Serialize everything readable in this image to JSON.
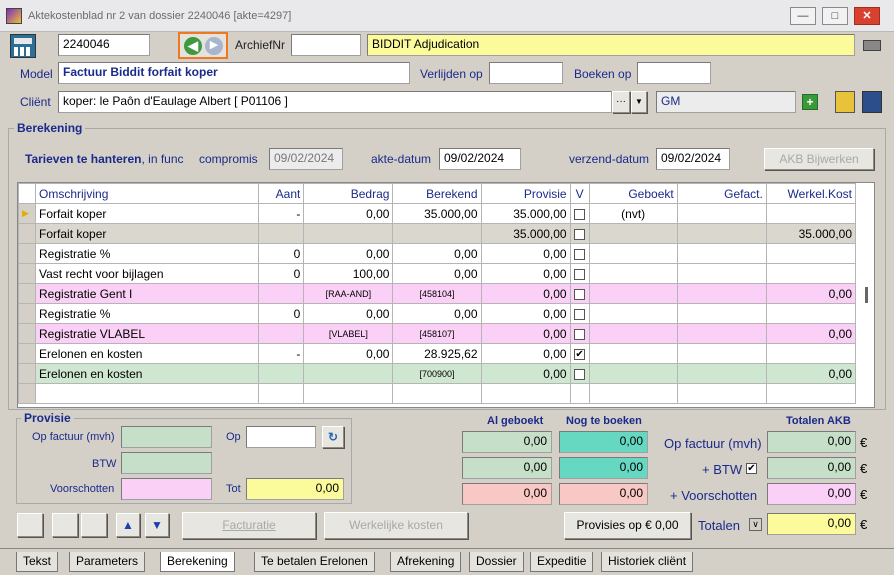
{
  "window": {
    "title": "Aktekostenblad nr 2 van dossier 2240046 [akte=4297]",
    "min": "—",
    "max": "□",
    "close": "✕"
  },
  "header": {
    "dossier_nr": "2240046",
    "archief_label": "ArchiefNr",
    "archief_value": "",
    "description": "BIDDIT Adjudication",
    "model_label": "Model",
    "model_value": "Factuur Biddit forfait koper",
    "verlijden_label": "Verlijden op",
    "verlijden_value": "",
    "boeken_label": "Boeken op",
    "boeken_value": "",
    "client_label": "Cliënt",
    "client_value": "koper: le Paôn d'Eaulage Albert [ P01106 ]",
    "client_code": "GM",
    "ellipsis": "···",
    "dropdown": "▼",
    "plus": "+"
  },
  "berekening": {
    "title": "Berekening",
    "tarieven": "Tarieven te hanteren",
    "infunc": ", in func",
    "compromis_label": "compromis",
    "compromis_value": "09/02/2024",
    "akte_label": "akte-datum",
    "akte_value": "09/02/2024",
    "verzend_label": "verzend-datum",
    "verzend_value": "09/02/2024",
    "akb_button": "AKB Bijwerken"
  },
  "table": {
    "headers": [
      "Omschrijving",
      "Aant",
      "Bedrag",
      "Berekend",
      "Provisie",
      "V",
      "Geboekt",
      "Gefact.",
      "Werkel.Kost"
    ],
    "rows": [
      {
        "style": "white",
        "ptr": "▶",
        "omschrijving": "Forfait koper",
        "aant": "-",
        "bedrag": "0,00",
        "berekend": "35.000,00",
        "provisie": "35.000,00",
        "v": "",
        "geboekt": "(nvt)",
        "gefact": "",
        "werkel": ""
      },
      {
        "style": "gray",
        "ptr": "",
        "omschrijving": "Forfait koper",
        "aant": "",
        "bedrag": "",
        "berekend": "",
        "provisie": "35.000,00",
        "v": "",
        "geboekt": "",
        "gefact": "",
        "werkel": "35.000,00"
      },
      {
        "style": "white",
        "ptr": "",
        "omschrijving": "Registratie %",
        "aant": "0",
        "bedrag": "0,00",
        "berekend": "0,00",
        "provisie": "0,00",
        "v": "",
        "geboekt": "",
        "gefact": "",
        "werkel": ""
      },
      {
        "style": "white",
        "ptr": "",
        "omschrijving": "Vast recht voor bijlagen",
        "aant": "0",
        "bedrag": "100,00",
        "berekend": "0,00",
        "provisie": "0,00",
        "v": "",
        "geboekt": "",
        "gefact": "",
        "werkel": ""
      },
      {
        "style": "pink",
        "ptr": "",
        "omschrijving": "Registratie Gent I",
        "aant": "",
        "bedrag": "[RAA-AND]",
        "berekend": "[458104]",
        "provisie": "0,00",
        "v": "",
        "geboekt": "",
        "gefact": "",
        "werkel": "0,00",
        "small": true
      },
      {
        "style": "white",
        "ptr": "",
        "omschrijving": "Registratie %",
        "aant": "0",
        "bedrag": "0,00",
        "berekend": "0,00",
        "provisie": "0,00",
        "v": "",
        "geboekt": "",
        "gefact": "",
        "werkel": ""
      },
      {
        "style": "pink",
        "ptr": "",
        "omschrijving": "Registratie VLABEL",
        "aant": "",
        "bedrag": "[VLABEL]",
        "berekend": "[458107]",
        "provisie": "0,00",
        "v": "",
        "geboekt": "",
        "gefact": "",
        "werkel": "0,00",
        "small": true
      },
      {
        "style": "white",
        "ptr": "",
        "omschrijving": "Erelonen en kosten",
        "aant": "-",
        "bedrag": "0,00",
        "berekend": "28.925,62",
        "provisie": "0,00",
        "v": "✔",
        "geboekt": "",
        "gefact": "",
        "werkel": ""
      },
      {
        "style": "green",
        "ptr": "",
        "omschrijving": "Erelonen en kosten",
        "aant": "",
        "bedrag": "",
        "berekend": "[700900]",
        "provisie": "0,00",
        "v": "",
        "geboekt": "",
        "gefact": "",
        "werkel": "0,00",
        "small2": true
      }
    ]
  },
  "provisie": {
    "title": "Provisie",
    "op_factuur_label": "Op factuur (mvh)",
    "btw_label": "BTW",
    "voorschotten_label": "Voorschotten",
    "op_label": "Op",
    "tot_label": "Tot",
    "tot_value": "0,00",
    "op_value": ""
  },
  "totals": {
    "al_geboekt": "Al geboekt",
    "nog_te_boeken": "Nog te boeken",
    "totalen_akb": "Totalen AKB",
    "op_factuur": "Op factuur (mvh)",
    "btw": "+ BTW",
    "voorschotten": "+ Voorschotten",
    "totalen": "Totalen",
    "rows": [
      {
        "a": "0,00",
        "b": "0,00",
        "c": "0,00"
      },
      {
        "a": "0,00",
        "b": "0,00",
        "c": "0,00"
      },
      {
        "a": "0,00",
        "b": "0,00",
        "c": "0,00"
      }
    ],
    "grand": "0,00",
    "euro": "€"
  },
  "buttons": {
    "facturatie": "Facturatie",
    "werkelijke_kosten": "Werkelijke kosten",
    "provisies": "Provisies op € 0,00"
  },
  "tabs": [
    "Tekst",
    "Parameters",
    "Berekening",
    "Te betalen Erelonen",
    "Afrekening",
    "Dossier",
    "Expeditie",
    "Historiek cliënt"
  ],
  "active_tab": "Berekening"
}
